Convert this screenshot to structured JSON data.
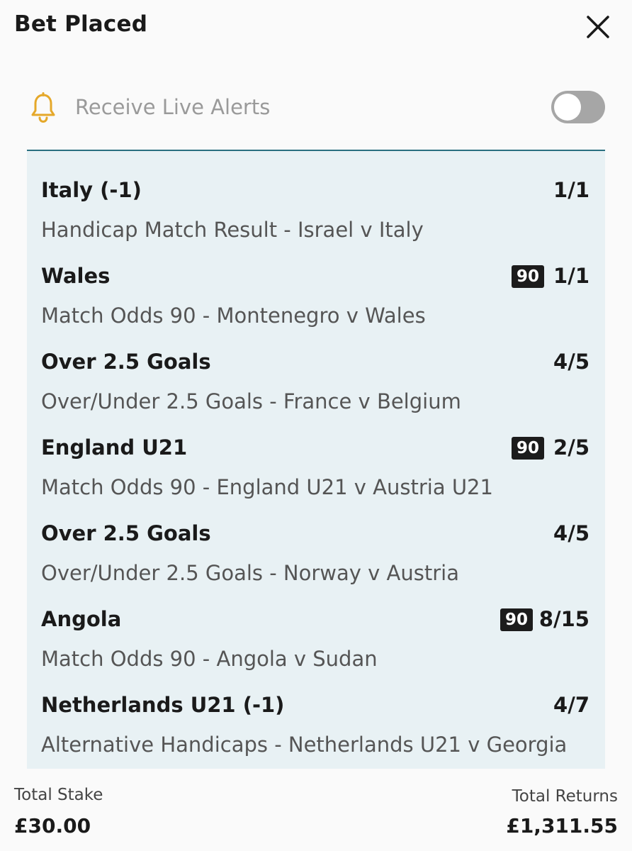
{
  "header": {
    "title": "Bet Placed",
    "close_icon": "close-icon"
  },
  "alerts": {
    "icon": "bell-icon",
    "icon_color": "#e5a82a",
    "label": "Receive Live Alerts",
    "toggle_on": false
  },
  "bets": [
    {
      "selection": "Italy (-1)",
      "odds": "1/1",
      "badge": "",
      "market": "Handicap Match Result - Israel v Italy"
    },
    {
      "selection": "Wales",
      "odds": "1/1",
      "badge": "90",
      "market": "Match Odds 90 - Montenegro v Wales"
    },
    {
      "selection": "Over 2.5 Goals",
      "odds": "4/5",
      "badge": "",
      "market": "Over/Under 2.5 Goals - France v Belgium"
    },
    {
      "selection": "England U21",
      "odds": "2/5",
      "badge": "90",
      "market": "Match Odds 90 - England U21 v Austria U21"
    },
    {
      "selection": "Over 2.5 Goals",
      "odds": "4/5",
      "badge": "",
      "market": "Over/Under 2.5 Goals - Norway v Austria"
    },
    {
      "selection": "Angola",
      "odds": "8/15",
      "badge": "90",
      "market": "Match Odds 90 - Angola v Sudan"
    },
    {
      "selection": "Netherlands U21 (-1)",
      "odds": "4/7",
      "badge": "",
      "market": "Alternative Handicaps - Netherlands U21 v Georgia"
    }
  ],
  "totals": {
    "stake_label": "Total Stake",
    "stake_value": "£30.00",
    "returns_label": "Total Returns",
    "returns_value": "£1,311.55"
  },
  "colors": {
    "panel_bg": "#e8f1f4",
    "panel_border": "#2a6f80",
    "toggle_off": "#a6a6a6"
  }
}
